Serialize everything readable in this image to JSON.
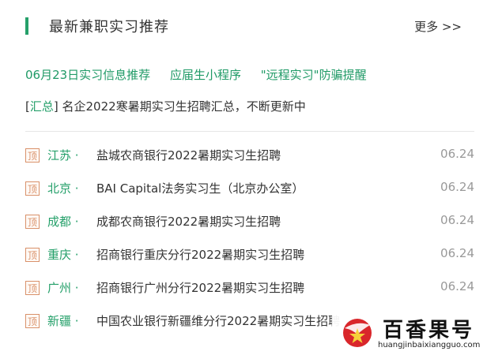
{
  "header": {
    "title": "最新兼职实习推荐",
    "more_label": "更多 >>"
  },
  "links": [
    "06月23日实习信息推荐",
    "应届生小程序",
    "\"远程实习\"防骗提醒"
  ],
  "summary": {
    "tag": "汇总",
    "text": "名企2022寒暑期实习生招聘汇总，不断更新中"
  },
  "list": [
    {
      "pin": "顶",
      "city": "江苏",
      "title": "盐城农商银行2022暑期实习生招聘",
      "date": "06.24"
    },
    {
      "pin": "顶",
      "city": "北京",
      "title": "BAI Capital法务实习生（北京办公室）",
      "date": "06.24"
    },
    {
      "pin": "顶",
      "city": "成都",
      "title": "成都农商银行2022暑期实习生招聘",
      "date": "06.24"
    },
    {
      "pin": "顶",
      "city": "重庆",
      "title": "招商银行重庆分行2022暑期实习生招聘",
      "date": "06.24"
    },
    {
      "pin": "顶",
      "city": "广州",
      "title": "招商银行广州分行2022暑期实习生招聘",
      "date": "06.24"
    },
    {
      "pin": "顶",
      "city": "新疆",
      "title": "中国农业银行新疆维分行2022暑期实习生招聘",
      "date": ""
    }
  ],
  "watermark": {
    "brand": "百香果号",
    "url": "huangjinbaixiangguo.com"
  },
  "colors": {
    "accent": "#25a06a",
    "pin": "#d9916a",
    "text": "#333333",
    "muted": "#999999"
  }
}
